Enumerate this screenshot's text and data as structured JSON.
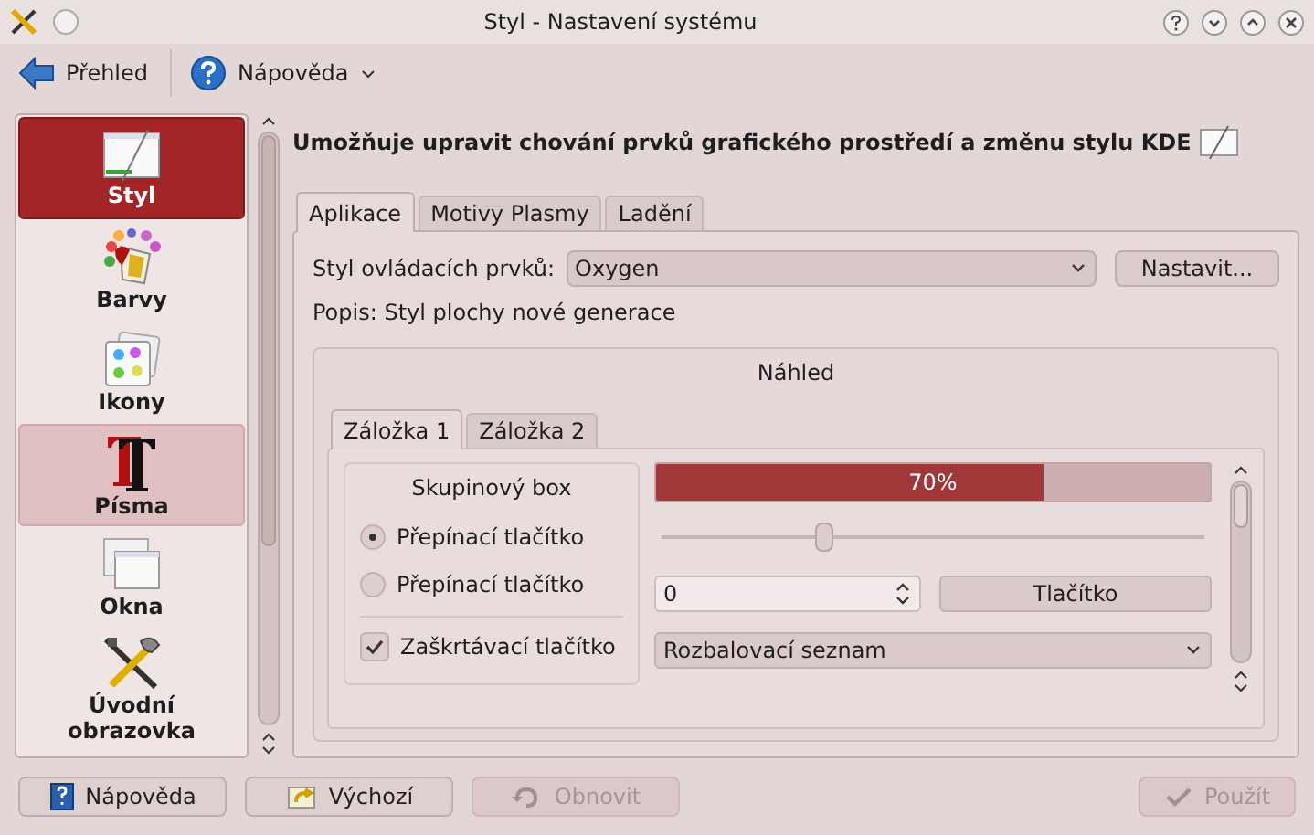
{
  "window": {
    "title": "Styl - Nastavení systému"
  },
  "toolbar": [
    {
      "label": "Přehled",
      "kind": "back",
      "dropdown": false
    },
    {
      "label": "Nápověda",
      "kind": "help",
      "dropdown": true
    }
  ],
  "sidebar": {
    "items": [
      {
        "label": "Styl",
        "kind": "style",
        "selected": true,
        "highlighted": false
      },
      {
        "label": "Barvy",
        "kind": "colors",
        "selected": false,
        "highlighted": false
      },
      {
        "label": "Ikony",
        "kind": "icons",
        "selected": false,
        "highlighted": false
      },
      {
        "label": "Písma",
        "kind": "fonts",
        "selected": false,
        "highlighted": true
      },
      {
        "label": "Okna",
        "kind": "windows",
        "selected": false,
        "highlighted": false
      },
      {
        "label": "Úvodní obrazovka",
        "kind": "splash",
        "selected": false,
        "highlighted": false
      }
    ]
  },
  "heading": "Umožňuje upravit chování prvků grafického prostředí a změnu stylu KDE",
  "tabs": [
    {
      "label": "Aplikace",
      "selected": true
    },
    {
      "label": "Motivy Plasmy",
      "selected": false
    },
    {
      "label": "Ladění",
      "selected": false
    }
  ],
  "style_field": {
    "label": "Styl ovládacích prvků:",
    "value": "Oxygen"
  },
  "configure_button": "Nastavit...",
  "description": "Popis: Styl plochy nové generace",
  "preview": {
    "title": "Náhled",
    "tabs": [
      {
        "label": "Záložka 1",
        "selected": true
      },
      {
        "label": "Záložka 2",
        "selected": false
      }
    ],
    "group_box": {
      "title": "Skupinový box",
      "radios": [
        {
          "label": "Přepínací tlačítko",
          "selected": true
        },
        {
          "label": "Přepínací tlačítko",
          "selected": false
        }
      ],
      "checkbox": {
        "label": "Zaškrtávací tlačítko",
        "checked": true
      }
    },
    "progress": {
      "level": 0.7,
      "reading": "70%"
    },
    "slider": {
      "level": 0.3
    },
    "spinbox": {
      "value": "0"
    },
    "button": "Tlačítko",
    "combo": {
      "value": "Rozbalovací seznam"
    }
  },
  "buttons": [
    {
      "label": "Nápověda",
      "kind": "help",
      "disabled": false
    },
    {
      "label": "Výchozí",
      "kind": "defaults",
      "disabled": false
    },
    {
      "label": "Obnovit",
      "kind": "reset",
      "disabled": true
    },
    {
      "label": "Použít",
      "kind": "apply",
      "disabled": true
    }
  ]
}
